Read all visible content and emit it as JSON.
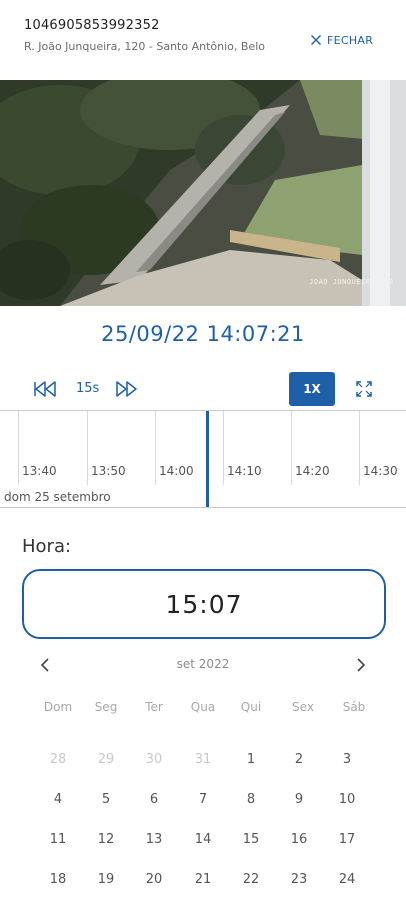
{
  "header": {
    "camera_id": "1046905853992352",
    "address": "R. João Junqueira, 120 - Santo Antônio, Belo",
    "close_label": "FECHAR"
  },
  "video": {
    "stamp": "JOAO JUNQUEIRA 120"
  },
  "playback": {
    "datetime": "25/09/22 14:07:21",
    "step_label": "15s",
    "speed_label": "1X"
  },
  "timeline": {
    "ticks": [
      "13:40",
      "13:50",
      "14:00",
      "14:10",
      "14:20",
      "14:30"
    ],
    "date_label": "dom 25 setembro"
  },
  "time_picker": {
    "label": "Hora:",
    "value": "15:07"
  },
  "calendar": {
    "month_label": "set 2022",
    "weekdays": [
      "Dom",
      "Seg",
      "Ter",
      "Qua",
      "Qui",
      "Sex",
      "Sáb"
    ],
    "weeks": [
      [
        {
          "d": "28",
          "m": true
        },
        {
          "d": "29",
          "m": true
        },
        {
          "d": "30",
          "m": true
        },
        {
          "d": "31",
          "m": true
        },
        {
          "d": "1"
        },
        {
          "d": "2"
        },
        {
          "d": "3"
        }
      ],
      [
        {
          "d": "4"
        },
        {
          "d": "5"
        },
        {
          "d": "6"
        },
        {
          "d": "7"
        },
        {
          "d": "8"
        },
        {
          "d": "9"
        },
        {
          "d": "10"
        }
      ],
      [
        {
          "d": "11"
        },
        {
          "d": "12"
        },
        {
          "d": "13"
        },
        {
          "d": "14"
        },
        {
          "d": "15"
        },
        {
          "d": "16"
        },
        {
          "d": "17"
        }
      ],
      [
        {
          "d": "18"
        },
        {
          "d": "19"
        },
        {
          "d": "20"
        },
        {
          "d": "21"
        },
        {
          "d": "22"
        },
        {
          "d": "23"
        },
        {
          "d": "24"
        }
      ]
    ]
  }
}
